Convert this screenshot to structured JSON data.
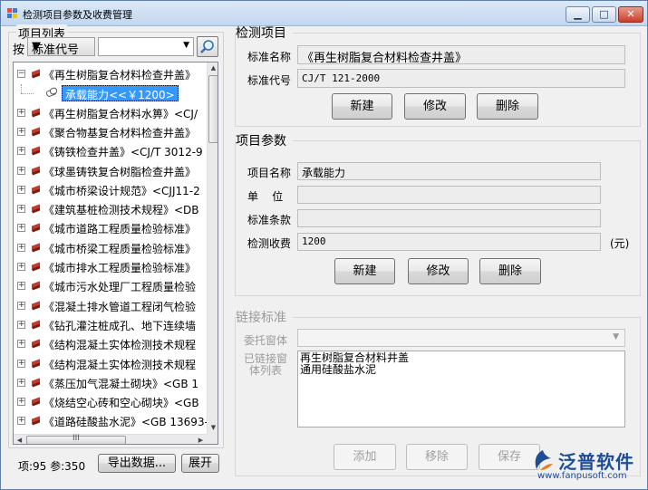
{
  "window": {
    "title": "检测项目参数及收费管理"
  },
  "left": {
    "group_title": "项目列表",
    "search_by_label": "按",
    "search_field_value": "标准代号",
    "search_value": "",
    "tree": [
      {
        "label": "《再生树脂复合材料检查井盖》",
        "expanded": true
      },
      {
        "label": "承载能力<<￥1200>",
        "child": true,
        "selected": true
      },
      {
        "label": "《再生树脂复合材料水箅》<CJ/"
      },
      {
        "label": "《聚合物基复合材料检查井盖》"
      },
      {
        "label": "《铸铁检查井盖》<CJ/T 3012-9"
      },
      {
        "label": "《球墨铸铁复合树脂检查井盖》"
      },
      {
        "label": "《城市桥梁设计规范》<CJJ11-2"
      },
      {
        "label": "《建筑基桩检测技术规程》<DB"
      },
      {
        "label": "《城市道路工程质量检验标准》"
      },
      {
        "label": "《城市桥梁工程质量检验标准》"
      },
      {
        "label": "《城市排水工程质量检验标准》"
      },
      {
        "label": "《城市污水处理厂工程质量检验"
      },
      {
        "label": "《混凝土排水管道工程闭气检验"
      },
      {
        "label": "《钻孔灌注桩成孔、地下连续墙"
      },
      {
        "label": "《结构混凝土实体检测技术规程"
      },
      {
        "label": "《结构混凝土实体检测技术规程"
      },
      {
        "label": "《蒸压加气混凝土砌块》<GB 1"
      },
      {
        "label": "《烧结空心砖和空心砌块》<GB"
      },
      {
        "label": "《道路硅酸盐水泥》<GB 13693-"
      }
    ],
    "hscroll_thumb_text": "III",
    "stats": "项:95 参:350",
    "export_button": "导出数据...",
    "expand_button": "展开"
  },
  "item": {
    "section_title": "检测项目",
    "name_label": "标准名称",
    "name_value": "《再生树脂复合材料检查井盖》",
    "code_label": "标准代号",
    "code_value": "CJ/T 121-2000",
    "new_button": "新建",
    "edit_button": "修改",
    "delete_button": "删除"
  },
  "params": {
    "section_title": "项目参数",
    "name_label": "项目名称",
    "name_value": "承载能力",
    "unit_label": "单    位",
    "unit_value": "",
    "clause_label": "标准条款",
    "clause_value": "",
    "fee_label": "检测收费",
    "fee_value": "1200",
    "fee_unit": "(元)",
    "new_button": "新建",
    "edit_button": "修改",
    "delete_button": "删除"
  },
  "link": {
    "section_title": "链接标准",
    "client_label": "委托窗体",
    "client_value": "",
    "list_label_1": "已链接窗",
    "list_label_2": "体列表",
    "list_items": [
      "再生树脂复合材料井盖",
      "通用硅酸盐水泥"
    ],
    "add_button": "添加",
    "remove_button": "移除",
    "save_button": "保存"
  },
  "watermark": {
    "name": "泛普软件",
    "url": "www.fanpusoft.com"
  },
  "colors": {
    "selection": "#3399ff",
    "brand": "#1f4d96",
    "book_red": "#c0392b"
  }
}
